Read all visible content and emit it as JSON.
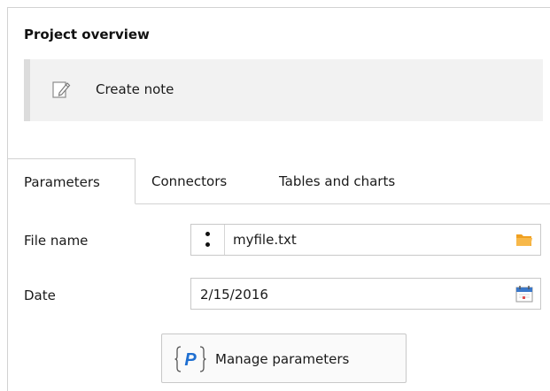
{
  "overview": {
    "title": "Project overview"
  },
  "note": {
    "label": "Create note",
    "icon": "edit-note-icon"
  },
  "tabs": [
    {
      "label": "Parameters",
      "active": true
    },
    {
      "label": "Connectors",
      "active": false
    },
    {
      "label": "Tables and charts",
      "active": false
    }
  ],
  "fields": {
    "file_name": {
      "label": "File name",
      "value": "myfile.txt",
      "icon": "folder-icon"
    },
    "date": {
      "label": "Date",
      "value": "2/15/2016",
      "icon": "calendar-icon"
    }
  },
  "manage_button": {
    "label": "Manage parameters",
    "icon_letter": "P"
  },
  "colors": {
    "folder": "#f5a623",
    "param_blue": "#1f6fd1",
    "calendar_blue": "#3b78c9"
  }
}
